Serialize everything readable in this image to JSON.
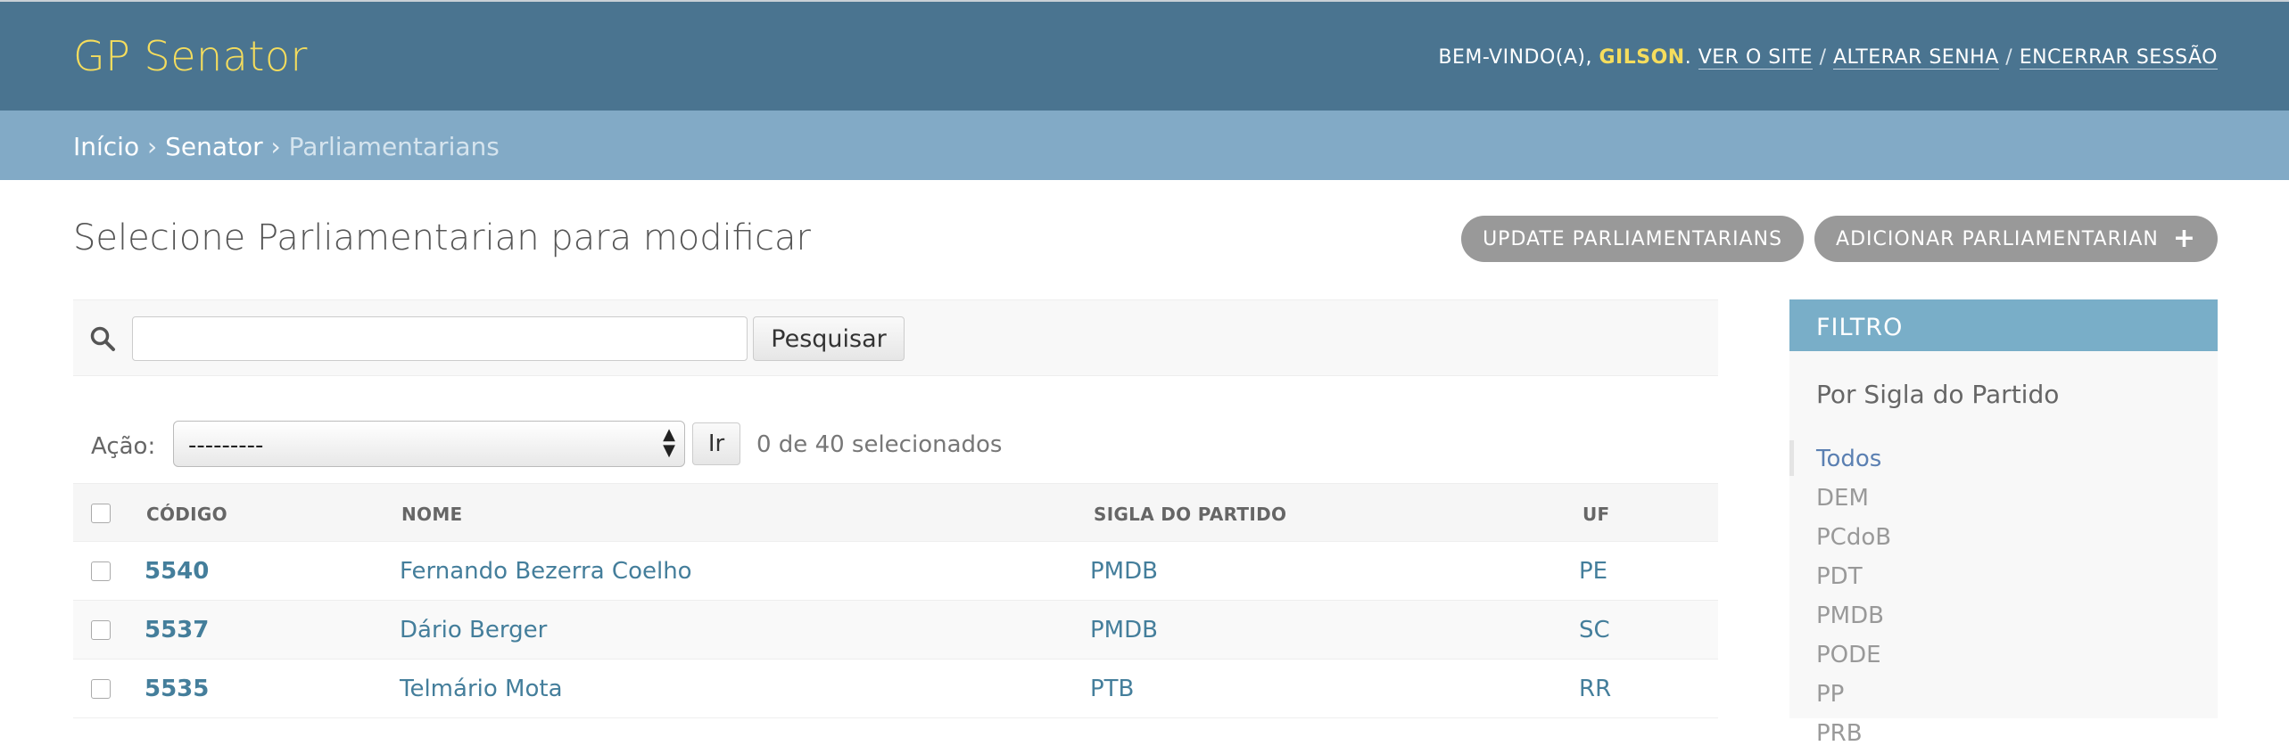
{
  "header": {
    "brand": "GP Senator",
    "welcome_prefix": "BEM-VINDO(A),",
    "username": "GILSON",
    "view_site": "VER O SITE",
    "change_password": "ALTERAR SENHA",
    "logout": "ENCERRAR SESSÃO",
    "separator": "/"
  },
  "breadcrumbs": {
    "home": "Início",
    "app": "Senator",
    "current": "Parliamentarians",
    "separator": "›"
  },
  "page": {
    "title": "Selecione Parliamentarian para modificar",
    "update_button": "UPDATE PARLIAMENTARIANS",
    "add_button": "ADICIONAR PARLIAMENTARIAN"
  },
  "search": {
    "value": "",
    "button": "Pesquisar"
  },
  "actions": {
    "label": "Ação:",
    "selected_option": "---------",
    "go": "Ir",
    "counter": "0 de 40 selecionados"
  },
  "table": {
    "columns": [
      "CÓDIGO",
      "NOME",
      "SIGLA DO PARTIDO",
      "UF"
    ],
    "rows": [
      {
        "codigo": "5540",
        "nome": "Fernando Bezerra Coelho",
        "partido": "PMDB",
        "uf": "PE"
      },
      {
        "codigo": "5537",
        "nome": "Dário Berger",
        "partido": "PMDB",
        "uf": "SC"
      },
      {
        "codigo": "5535",
        "nome": "Telmário Mota",
        "partido": "PTB",
        "uf": "RR"
      }
    ]
  },
  "filter": {
    "title": "FILTRO",
    "subtitle": "Por Sigla do Partido",
    "items": [
      "Todos",
      "DEM",
      "PCdoB",
      "PDT",
      "PMDB",
      "PODE",
      "PP",
      "PRB"
    ],
    "selected": "Todos"
  },
  "colors": {
    "header_bg": "#4a7490",
    "brand": "#f5dd5d",
    "breadcrumb_bg": "#82aac6",
    "filter_title_bg": "#79aec8",
    "link": "#447e9b",
    "tool_button_bg": "#999999"
  }
}
